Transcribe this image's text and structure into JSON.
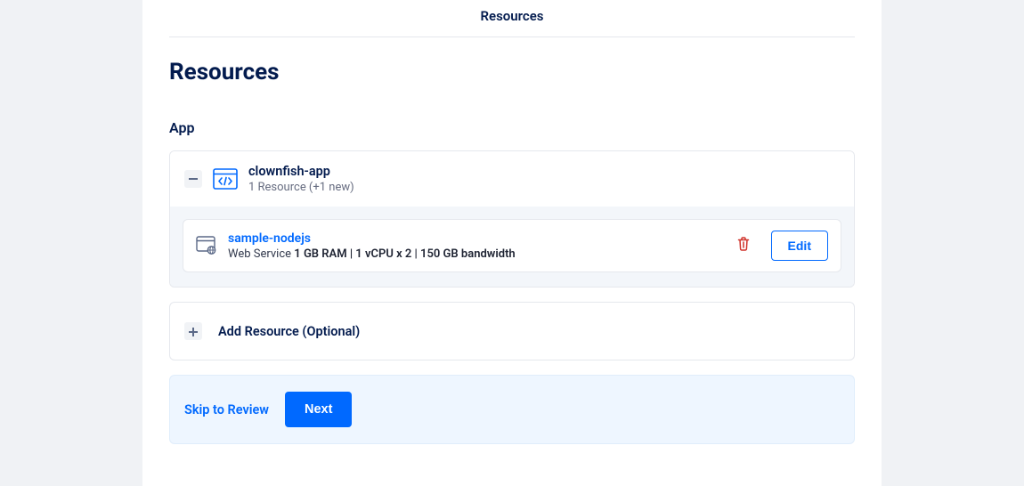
{
  "tab": {
    "label": "Resources"
  },
  "page": {
    "title": "Resources"
  },
  "section": {
    "app_label": "App"
  },
  "app": {
    "name": "clownfish-app",
    "subtitle": "1 Resource (+1 new)"
  },
  "resource": {
    "name": "sample-nodejs",
    "kind": "Web Service ",
    "spec": "1 GB RAM | 1 vCPU x 2 | 150 GB bandwidth",
    "edit_label": "Edit"
  },
  "add_resource": {
    "label": "Add Resource (Optional)"
  },
  "footer": {
    "skip_label": "Skip to Review",
    "next_label": "Next"
  }
}
